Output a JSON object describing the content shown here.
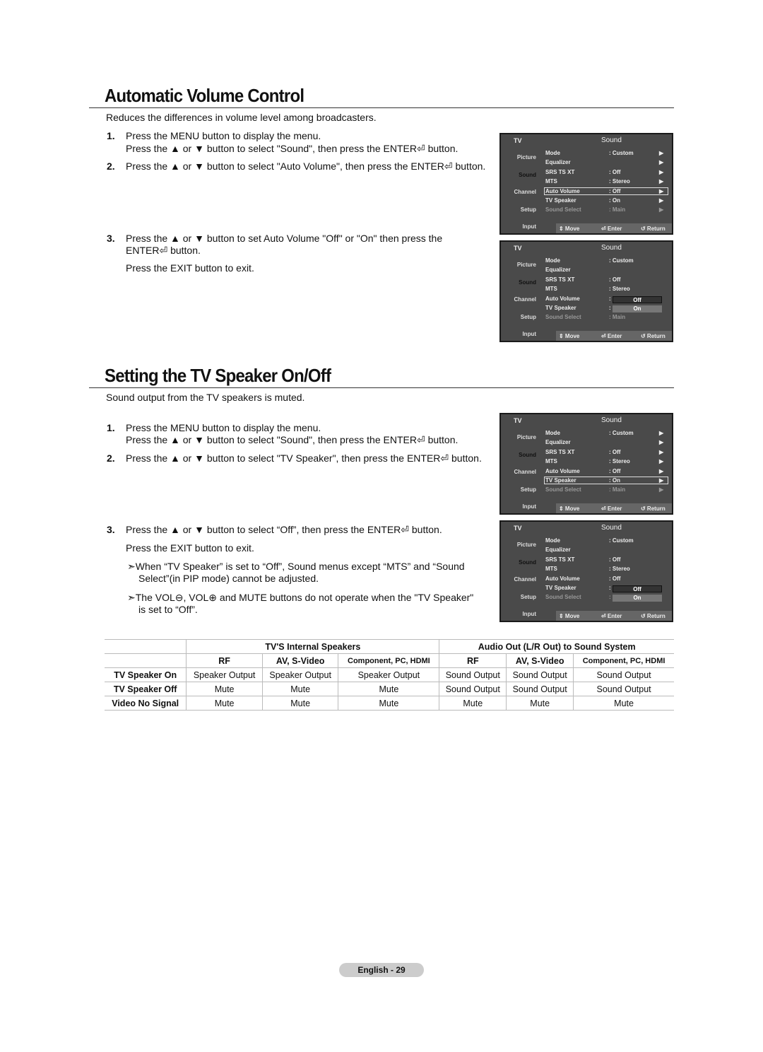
{
  "section1": {
    "title": "Automatic Volume Control",
    "desc": "Reduces the differences in volume level among broadcasters.",
    "steps": [
      {
        "num": "1.",
        "lines": [
          "Press the MENU button to display the menu.",
          "Press the ▲ or ▼ button to select \"Sound\", then press the ENTER⏎ button."
        ]
      },
      {
        "num": "2.",
        "lines": [
          "Press the ▲ or ▼ button to select \"Auto Volume\", then press the ENTER⏎ button."
        ]
      },
      {
        "num": "3.",
        "lines": [
          "Press the ▲ or ▼ button to set Auto Volume \"Off\" or \"On\" then press the",
          "ENTER⏎ button.",
          "Press the EXIT button to exit."
        ]
      }
    ]
  },
  "section2": {
    "title": "Setting the TV Speaker On/Off",
    "desc": "Sound output from the TV speakers is muted.",
    "steps": [
      {
        "num": "1.",
        "lines": [
          "Press the MENU button to display the menu.",
          "Press the ▲ or ▼ button to select \"Sound\", then press the ENTER⏎ button."
        ]
      },
      {
        "num": "2.",
        "lines": [
          "Press the ▲ or ▼ button to select \"TV Speaker\", then press the ENTER⏎ button."
        ]
      },
      {
        "num": "3.",
        "lines": [
          "Press the ▲ or ▼ button to select “Off”, then press the ENTER⏎ button.",
          "Press the EXIT button to exit."
        ]
      }
    ],
    "notes": [
      [
        "➣When “TV Speaker” is set to “Off”, Sound menus except “MTS” and “Sound",
        "Select”(in PIP mode) cannot be adjusted."
      ],
      [
        "➣The VOL⊖, VOL⊕ and MUTE buttons do not operate when the \"TV Speaker\"",
        "is set to “Off”."
      ]
    ]
  },
  "menu_common": {
    "tv": "TV",
    "title": "Sound",
    "side": [
      "Picture",
      "Sound",
      "Channel",
      "Setup",
      "Input"
    ],
    "active_side": 1,
    "foot": [
      "⇕ Move",
      "⏎ Enter",
      "↺ Return"
    ],
    "items": [
      "Mode",
      "Equalizer",
      "SRS TS XT",
      "MTS",
      "Auto Volume",
      "TV Speaker",
      "Sound Select"
    ]
  },
  "menus": [
    {
      "values": [
        ": Custom",
        "",
        ": Off",
        ": Stereo",
        ": Off",
        ": On",
        ": Main"
      ],
      "arrows": true,
      "highlight": 4,
      "popup": null
    },
    {
      "values": [
        ": Custom",
        "",
        ": Off",
        ": Stereo",
        ":",
        ":",
        ": Main"
      ],
      "arrows": false,
      "highlight": null,
      "popup": {
        "row": 4,
        "options": [
          "Off",
          "On"
        ],
        "selected": 0
      }
    },
    {
      "values": [
        ": Custom",
        "",
        ": Off",
        ": Stereo",
        ": Off",
        ": On",
        ": Main"
      ],
      "arrows": true,
      "highlight": 5,
      "popup": null
    },
    {
      "values": [
        ": Custom",
        "",
        ": Off",
        ": Stereo",
        ": Off",
        ":",
        ":"
      ],
      "arrows": false,
      "highlight": null,
      "popup": {
        "row": 5,
        "options": [
          "Off",
          "On"
        ],
        "selected": 0
      }
    }
  ],
  "table": {
    "group_headers": [
      "TV'S Internal Speakers",
      "Audio Out (L/R Out) to Sound System"
    ],
    "sub_headers": [
      "RF",
      "AV, S-Video",
      "Component, PC, HDMI",
      "RF",
      "AV, S-Video",
      "Component, PC, HDMI"
    ],
    "rows": [
      {
        "label": "TV Speaker On",
        "cells": [
          "Speaker Output",
          "Speaker Output",
          "Speaker Output",
          "Sound Output",
          "Sound Output",
          "Sound Output"
        ]
      },
      {
        "label": "TV Speaker Off",
        "cells": [
          "Mute",
          "Mute",
          "Mute",
          "Sound Output",
          "Sound Output",
          "Sound Output"
        ]
      },
      {
        "label": "Video No Signal",
        "cells": [
          "Mute",
          "Mute",
          "Mute",
          "Mute",
          "Mute",
          "Mute"
        ]
      }
    ]
  },
  "footer": "English - 29"
}
